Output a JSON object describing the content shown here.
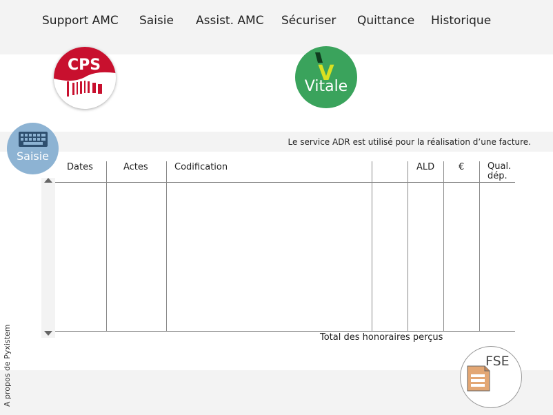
{
  "nav": {
    "items": [
      "Support AMC",
      "Saisie",
      "Assist. AMC",
      "Sécuriser",
      "Quittance",
      "Historique"
    ]
  },
  "cards": {
    "cps_label": "CPS",
    "vitale_label": "Vitale",
    "vitale_mark": "V",
    "saisie_label": "Saisie",
    "fse_label": "FSE"
  },
  "info": {
    "message": "Le service ADR est utilisé pour la réalisation d’une facture."
  },
  "table": {
    "columns": [
      "Dates",
      "Actes",
      "Codification",
      "",
      "ALD",
      "€",
      "Qual. dép."
    ],
    "col_qual_line1": "Qual.",
    "col_qual_line2": "dép.",
    "rows": []
  },
  "footer": {
    "total_label": "Total des honoraires perçus",
    "about_link": "A propos de Pyxistem"
  },
  "icons": {
    "cps": "cps-card-icon",
    "vitale": "vitale-card-icon",
    "saisie": "keyboard-icon",
    "fse": "document-icon"
  },
  "colors": {
    "cps_red": "#c8102e",
    "vitale_green": "#3aa35c",
    "saisie_blue": "#8db3d3",
    "document_tan": "#e3a774"
  }
}
